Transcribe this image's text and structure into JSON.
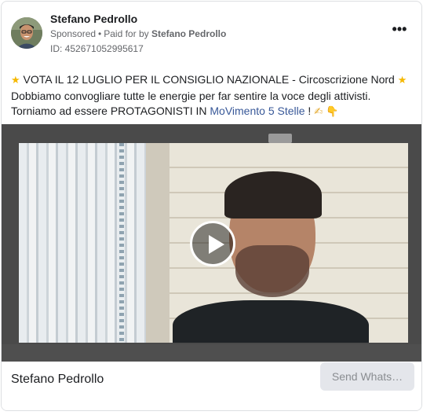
{
  "post": {
    "author": "Stefano Pedrollo",
    "sponsored_label": "Sponsored",
    "paid_for_prefix": "Paid for by",
    "paid_for_name": "Stefano Pedrollo",
    "ad_id": "ID: 452671052995617",
    "more_glyph": "•••"
  },
  "body": {
    "line1_text": "VOTA IL 12 LUGLIO PER IL CONSIGLIO NAZIONALE - Circoscrizione Nord",
    "line2_text": "Dobbiamo convogliare tutte le energie per far sentire la voce degli attivisti.",
    "line3_prefix": "Torniamo ad essere PROTAGONISTI IN",
    "line3_link": "MoVimento 5 Stelle",
    "line3_suffix": "!",
    "star_icon": "★",
    "writing_hand_icon": "✍",
    "pointing_down_icon": "👇"
  },
  "video": {
    "play_icon": "play-icon"
  },
  "footer": {
    "title": "Stefano Pedrollo",
    "cta_label": "Send Whats…"
  }
}
